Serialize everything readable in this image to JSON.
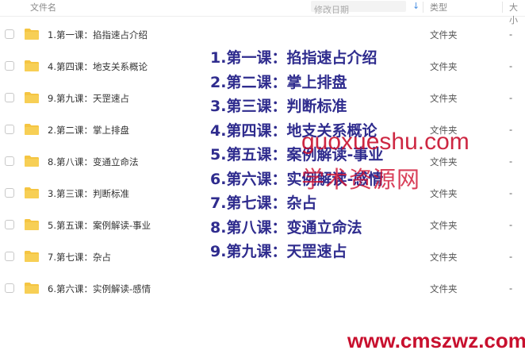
{
  "header": {
    "name_label": "文件名",
    "date_label": "修改日期",
    "sort_arrow": "↓",
    "type_label": "类型",
    "size_label": "大小"
  },
  "files": [
    {
      "name": "1.第一课：掐指速占介绍",
      "type": "文件夹",
      "size": "-"
    },
    {
      "name": "4.第四课：地支关系概论",
      "type": "文件夹",
      "size": "-"
    },
    {
      "name": "9.第九课：天罡速占",
      "type": "文件夹",
      "size": "-"
    },
    {
      "name": "2.第二课：掌上排盘",
      "type": "文件夹",
      "size": "-"
    },
    {
      "name": "8.第八课：变通立命法",
      "type": "文件夹",
      "size": "-"
    },
    {
      "name": "3.第三课：判断标准",
      "type": "文件夹",
      "size": "-"
    },
    {
      "name": "5.第五课：案例解读-事业",
      "type": "文件夹",
      "size": "-"
    },
    {
      "name": "7.第七课：杂占",
      "type": "文件夹",
      "size": "-"
    },
    {
      "name": "6.第六课：实例解读-感情",
      "type": "文件夹",
      "size": "-"
    }
  ],
  "overlay_list": [
    "1.第一课：掐指速占介绍",
    "2.第二课：掌上排盘",
    "3.第三课：判断标准",
    "4.第四课：地支关系概论",
    "5.第五课：案例解读-事业",
    "6.第六课：实例解读-感情",
    "7.第七课：杂占",
    "8.第八课：变通立命法",
    "9.第九课：天罡速占"
  ],
  "watermarks": {
    "line1": "guoxueshu.com",
    "line2": "学术资源网",
    "line3": "www.cmszwz.com"
  },
  "colors": {
    "folder": "#f5c542",
    "overlay_text": "#2f2c8e",
    "watermark": "#c8102e"
  }
}
